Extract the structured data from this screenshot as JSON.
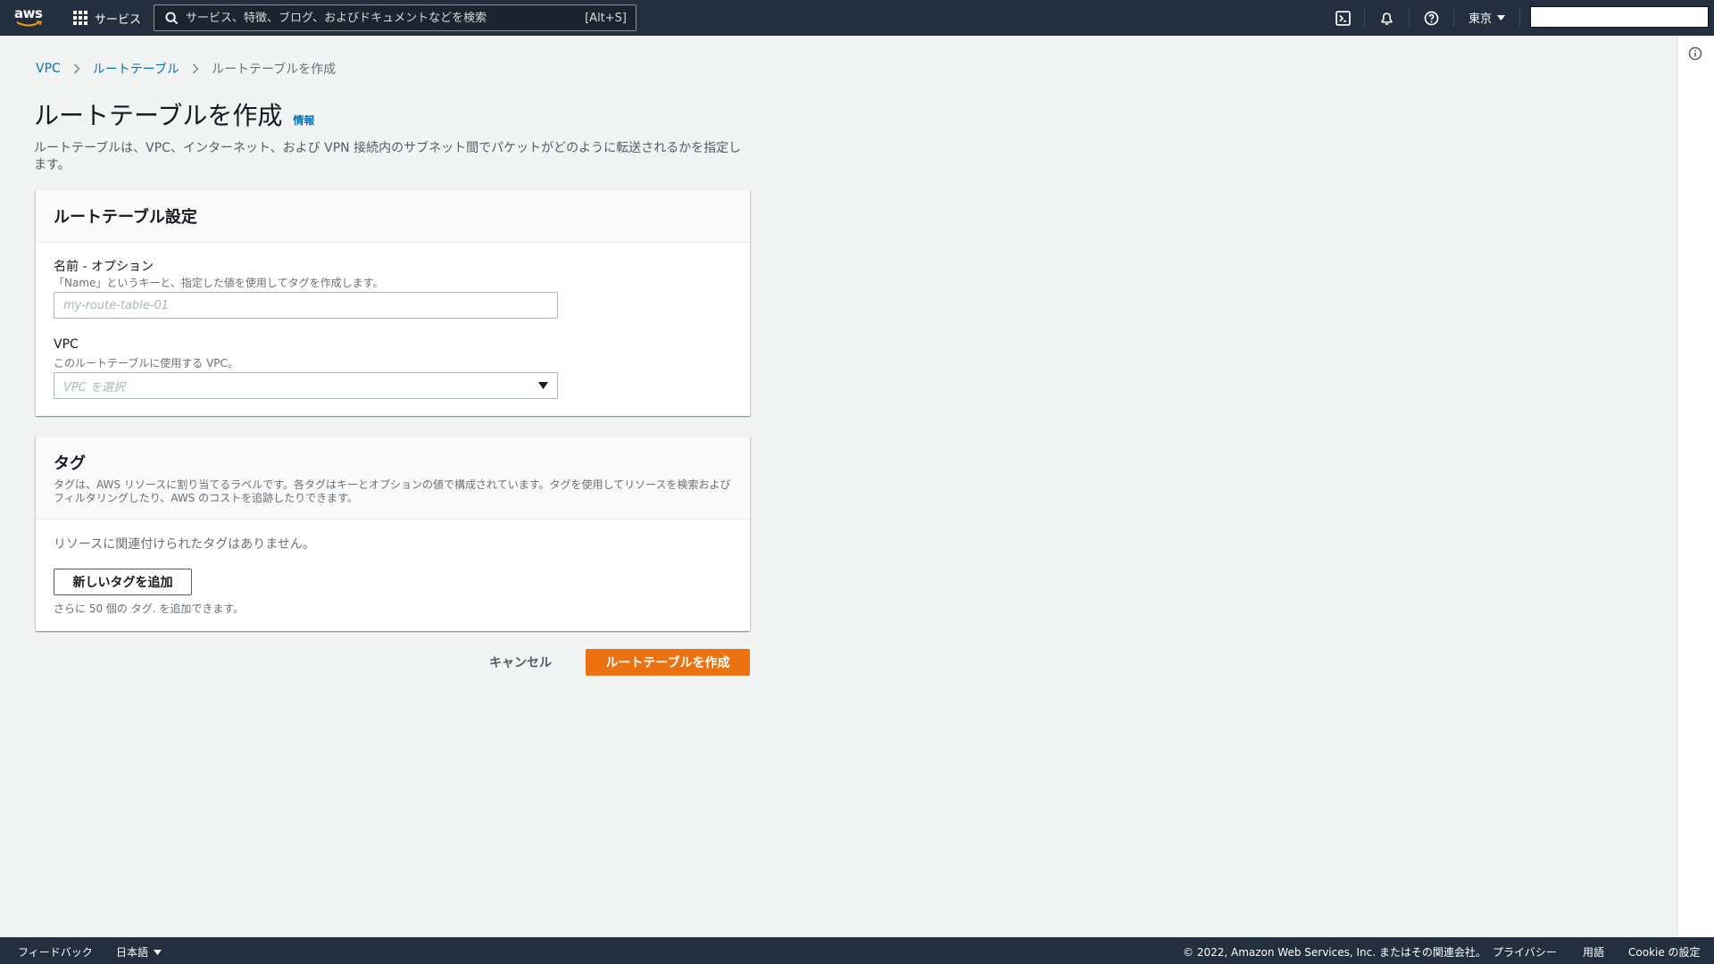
{
  "topnav": {
    "logo_text": "aws",
    "services_label": "サービス",
    "search_placeholder": "サービス、特徴、ブログ、およびドキュメントなどを検索",
    "search_shortcut": "[Alt+S]",
    "region_label": "東京"
  },
  "breadcrumb": {
    "items": [
      "VPC",
      "ルートテーブル"
    ],
    "current": "ルートテーブルを作成"
  },
  "page": {
    "title": "ルートテーブルを作成",
    "info_link": "情報",
    "description": "ルートテーブルは、VPC、インターネット、および VPN 接続内のサブネット間でパケットがどのように転送されるかを指定します。"
  },
  "settings_panel": {
    "title": "ルートテーブル設定",
    "name_label": "名前 - オプション",
    "name_desc": "「Name」というキーと、指定した値を使用してタグを作成します。",
    "name_placeholder": "my-route-table-01",
    "name_value": "",
    "vpc_label": "VPC",
    "vpc_desc": "このルートテーブルに使用する VPC。",
    "vpc_placeholder": "VPC を選択"
  },
  "tags_panel": {
    "title": "タグ",
    "description": "タグは、AWS リソースに割り当てるラベルです。各タグはキーとオプションの値で構成されています。タグを使用してリソースを検索およびフィルタリングしたり、AWS のコストを追跡したりできます。",
    "empty_text": "リソースに関連付けられたタグはありません。",
    "add_button": "新しいタグを追加",
    "limit_text": "さらに 50 個の タグ. を追加できます。"
  },
  "actions": {
    "cancel": "キャンセル",
    "submit": "ルートテーブルを作成"
  },
  "footer": {
    "feedback": "フィードバック",
    "language": "日本語",
    "copyright": "© 2022, Amazon Web Services, Inc. またはその関連会社。",
    "privacy": "プライバシー",
    "terms": "用語",
    "cookie": "Cookie の設定"
  },
  "colors": {
    "nav_bg": "#232f3e",
    "primary": "#ec7211",
    "link": "#0073bb",
    "page_bg": "#f2f3f3"
  },
  "icons": {
    "services": "grid-icon",
    "search": "search-icon",
    "cloudshell": "terminal-icon",
    "notifications": "bell-icon",
    "help": "help-icon",
    "tools": "info-icon",
    "select": "caret-down-icon"
  }
}
